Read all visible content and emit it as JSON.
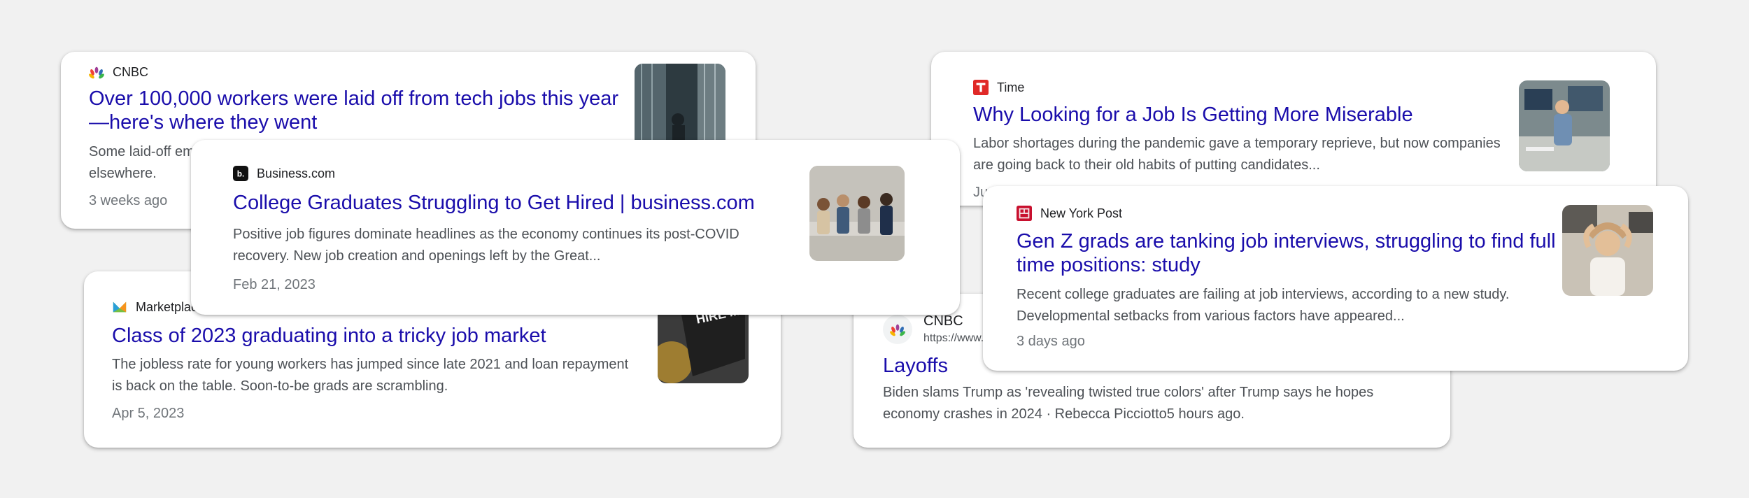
{
  "cards": {
    "cnbc_layoffs": {
      "source": "CNBC",
      "title": "Over 100,000 workers were laid off from tech jobs this year—here's where they went",
      "snippet": "Some laid-off employees found new jobs quickly, while others continued their careers elsewhere.",
      "date": "3 weeks ago",
      "thumb_icon": "office-building-photo"
    },
    "marketplace": {
      "source": "Marketplace",
      "title": "Class of 2023 graduating into a tricky job market",
      "snippet": "The jobless rate for young workers has jumped since late 2021 and loan repayment is back on the table. Soon-to-be grads are scrambling.",
      "date": "Apr 5, 2023",
      "thumb_icon": "hire-me-sign-photo",
      "thumb_text": "HIRE ME"
    },
    "business_com": {
      "source": "Business.com",
      "title": "College Graduates Struggling to Get Hired | business.com",
      "snippet": "Positive job figures dominate headlines as the economy continues its post-COVID recovery. New job creation and openings left by the Great...",
      "date": "Feb 21, 2023",
      "thumb_icon": "candidates-waiting-photo"
    },
    "time": {
      "source": "Time",
      "title": "Why Looking for a Job Is Getting More Miserable",
      "snippet": "Labor shortages during the pandemic gave a temporary reprieve, but now companies are going back to their old habits of putting candidates...",
      "date": "Jun",
      "thumb_icon": "office-worker-photo"
    },
    "cnbc_trump": {
      "source": "CNBC",
      "url": "https://www...",
      "title": "Layoffs",
      "snippet": "Biden slams Trump as 'revealing twisted true colors' after Trump says he hopes economy crashes in 2024 · Rebecca Picciotto5 hours ago."
    },
    "nypost": {
      "source": "New York Post",
      "title": "Gen Z grads are tanking job interviews, struggling to find full time positions: study",
      "snippet": "Recent college graduates are failing at job interviews, according to a new study. Developmental setbacks from various factors have appeared...",
      "date": "3 days ago",
      "thumb_icon": "relaxed-woman-laptop-photo"
    }
  },
  "colors": {
    "background": "#f1f1f1",
    "title_link": "#1a0dab",
    "snippet": "#4d5156",
    "meta": "#70757a",
    "time_brand": "#e02927",
    "nypost_brand": "#c8102e"
  }
}
